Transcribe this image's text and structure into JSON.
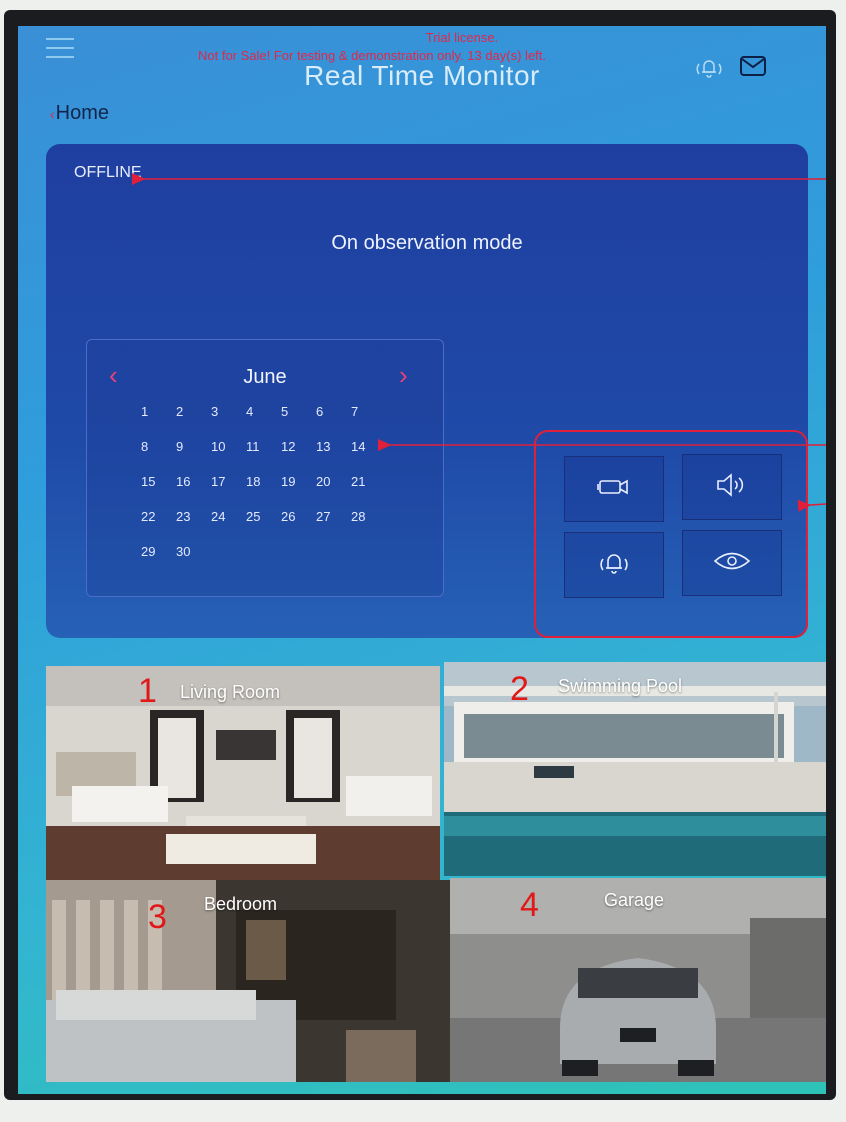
{
  "header": {
    "title": "Real Time Monitor",
    "trial_line1": "Trial license.",
    "trial_line2": "Not for Sale! For testing & demonstration only. 13 day(s) left.",
    "icons": [
      "menu-icon",
      "alarm-bell-icon",
      "mail-icon"
    ]
  },
  "breadcrumb": {
    "label": "Home"
  },
  "status_panel": {
    "status": "OFFLINE",
    "mode": "On observation mode"
  },
  "calendar": {
    "month": "June",
    "prev_icon": "chevron-left-icon",
    "next_icon": "chevron-right-icon",
    "weeks": [
      [
        "1",
        "2",
        "3",
        "4",
        "5",
        "6",
        "7"
      ],
      [
        "8",
        "9",
        "10",
        "11",
        "12",
        "13",
        "14"
      ],
      [
        "15",
        "16",
        "17",
        "18",
        "19",
        "20",
        "21"
      ],
      [
        "22",
        "23",
        "24",
        "25",
        "26",
        "27",
        "28"
      ],
      [
        "29",
        "30"
      ]
    ]
  },
  "controls": [
    {
      "name": "camera",
      "icon": "camera-icon"
    },
    {
      "name": "speaker",
      "icon": "speaker-icon"
    },
    {
      "name": "alarm",
      "icon": "alarm-bell-icon"
    },
    {
      "name": "observe",
      "icon": "eye-icon"
    }
  ],
  "rooms": [
    {
      "number": "1",
      "label": "Living Room"
    },
    {
      "number": "2",
      "label": "Swimming Pool"
    },
    {
      "number": "3",
      "label": "Bedroom"
    },
    {
      "number": "4",
      "label": "Garage"
    }
  ],
  "colors": {
    "annotation": "#e0203a",
    "accent_pink": "#e8407a",
    "panel": "#1f3fa0"
  }
}
